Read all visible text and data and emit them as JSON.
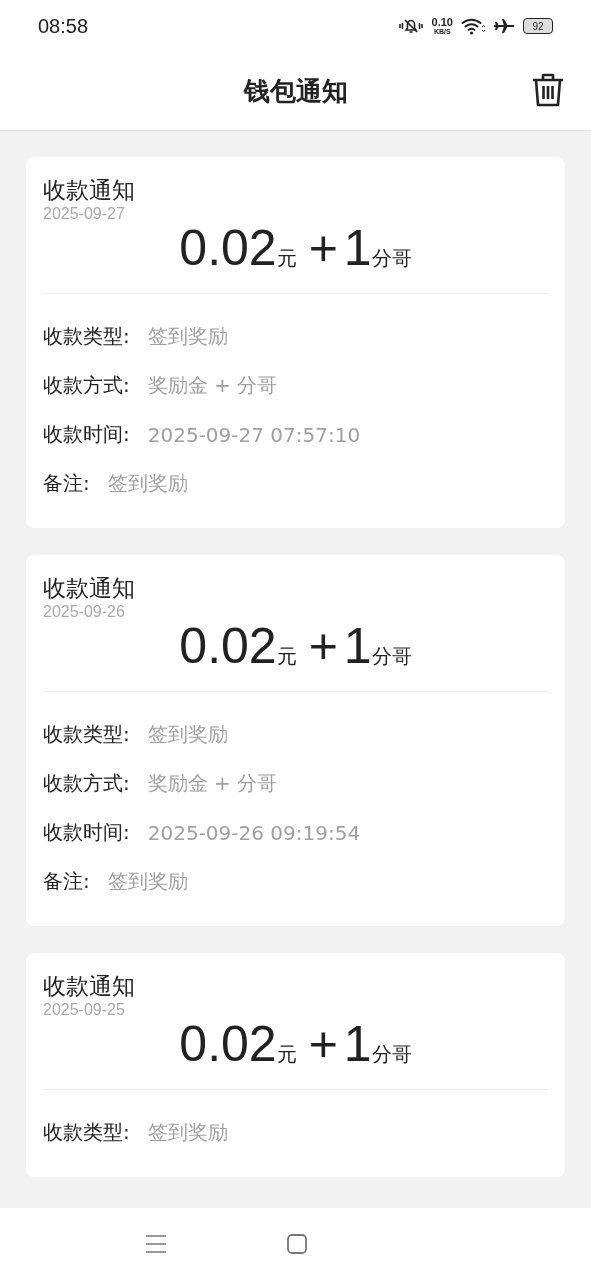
{
  "status_bar": {
    "time": "08:58",
    "speed_value": "0.10",
    "speed_unit": "KB/S",
    "battery": "92"
  },
  "header": {
    "title": "钱包通知"
  },
  "notifications": [
    {
      "title": "收款通知",
      "date": "2025-09-27",
      "amount": "0.02",
      "amount_unit": "元",
      "plus": "+",
      "points": "1",
      "points_unit": "分哥",
      "fields": [
        {
          "label": "收款类型:",
          "value": "签到奖励"
        },
        {
          "label": "收款方式:",
          "value": "奖励金 + 分哥"
        },
        {
          "label": "收款时间:",
          "value": "2025-09-27 07:57:10"
        },
        {
          "label": "备注:",
          "value": "签到奖励"
        }
      ]
    },
    {
      "title": "收款通知",
      "date": "2025-09-26",
      "amount": "0.02",
      "amount_unit": "元",
      "plus": "+",
      "points": "1",
      "points_unit": "分哥",
      "fields": [
        {
          "label": "收款类型:",
          "value": "签到奖励"
        },
        {
          "label": "收款方式:",
          "value": "奖励金 + 分哥"
        },
        {
          "label": "收款时间:",
          "value": "2025-09-26 09:19:54"
        },
        {
          "label": "备注:",
          "value": "签到奖励"
        }
      ]
    },
    {
      "title": "收款通知",
      "date": "2025-09-25",
      "amount": "0.02",
      "amount_unit": "元",
      "plus": "+",
      "points": "1",
      "points_unit": "分哥",
      "fields": [
        {
          "label": "收款类型:",
          "value": "签到奖励"
        }
      ]
    }
  ]
}
